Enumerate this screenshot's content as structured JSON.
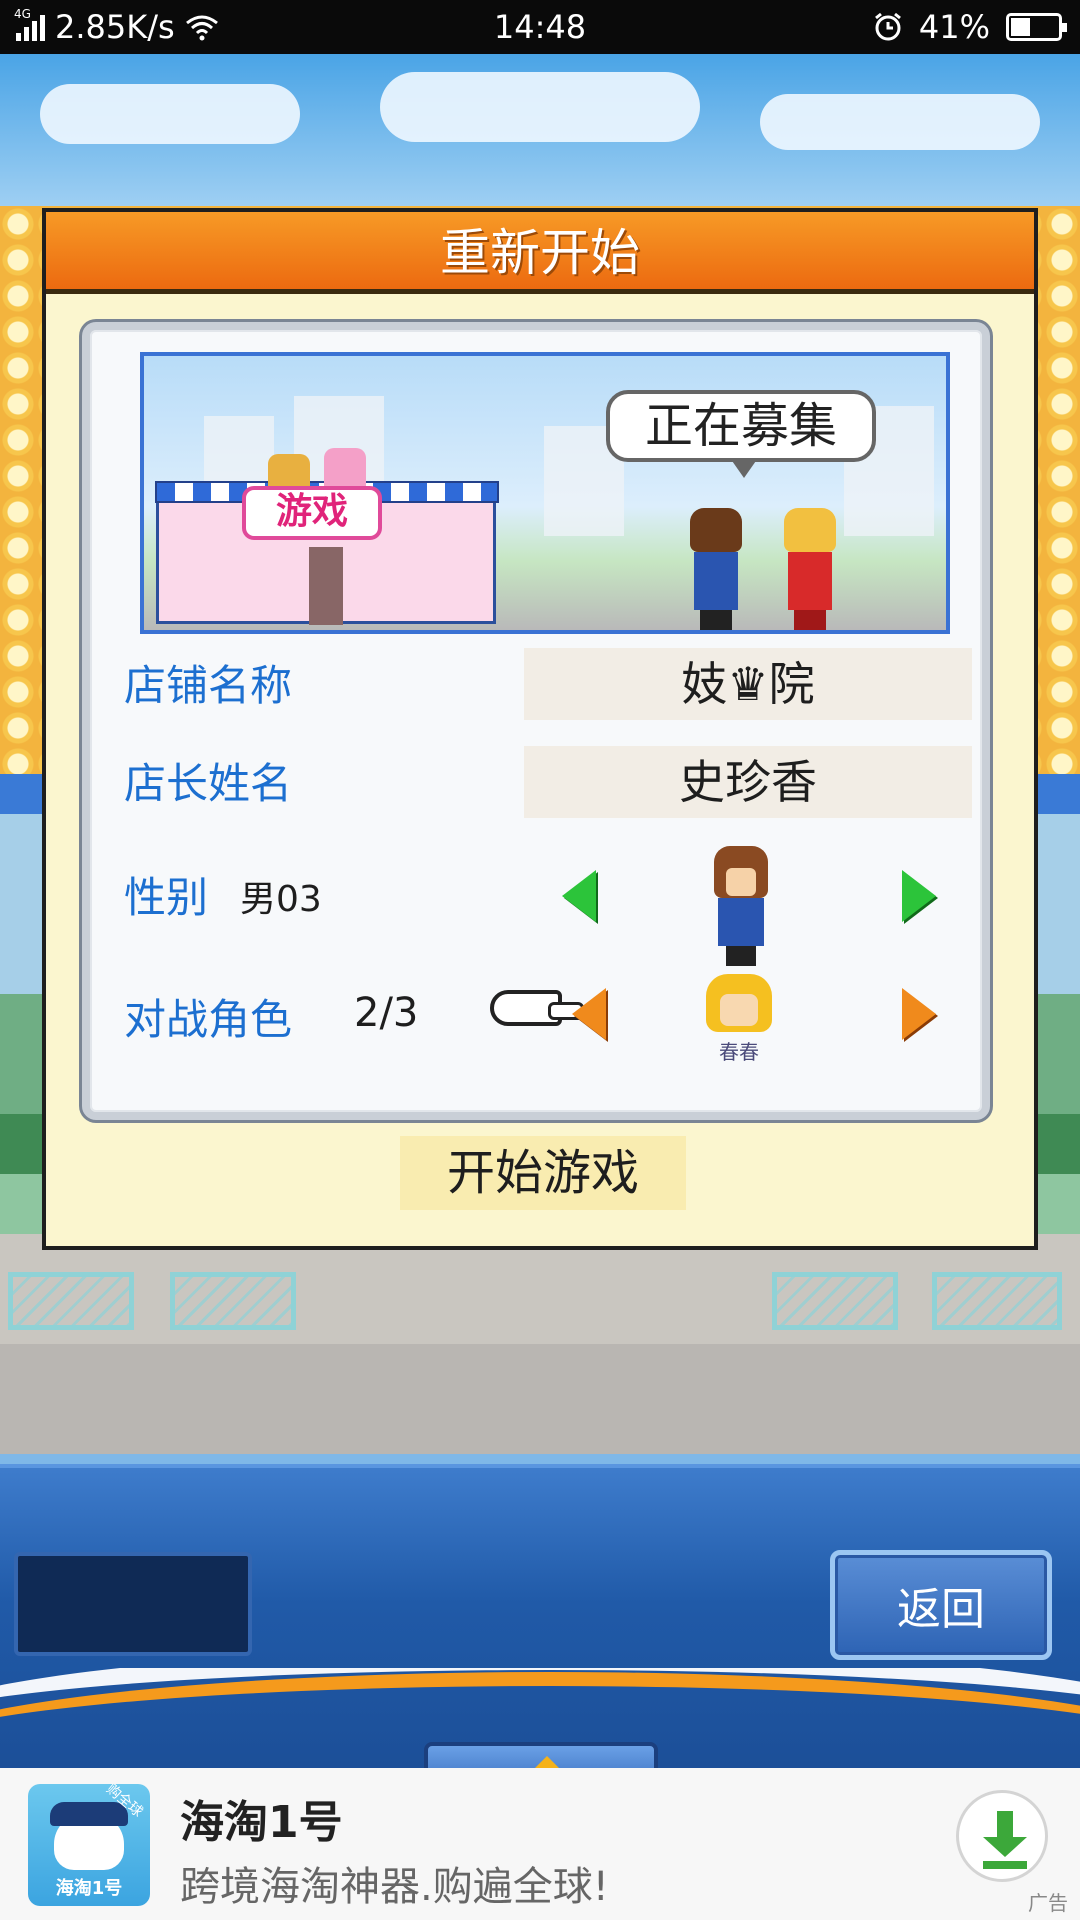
{
  "status_bar": {
    "network_type": "4G",
    "speed": "2.85K/s",
    "time": "14:48",
    "battery": "41%",
    "battery_level": 0.41,
    "icons": [
      "signal-icon",
      "wifi-icon",
      "alarm-icon",
      "battery-icon"
    ]
  },
  "dialog": {
    "title": "重新开始",
    "preview": {
      "shop_sign": "游戏",
      "speech_bubble": "正在募集"
    },
    "rows": {
      "shop_name_label": "店铺名称",
      "shop_name_value": "妓♛院",
      "manager_label": "店长姓名",
      "manager_value": "史珍香",
      "gender_label": "性别",
      "gender_value": "男03",
      "rival_label": "对战角色",
      "rival_value": "2/3",
      "rival_character_name": "春春"
    },
    "start_button": "开始游戏"
  },
  "bottom_ui": {
    "back_button": "返回"
  },
  "ad": {
    "title": "海淘1号",
    "subtitle": "跨境海淘神器.购遍全球!",
    "app_icon_label": "海淘1号",
    "app_icon_tag": "购全球",
    "ad_mark": "广告"
  },
  "colors": {
    "title_bar": "#ec6a10",
    "label_blue": "#1c6fd0",
    "green_arrow": "#2cc43a",
    "orange_arrow": "#f08a1c"
  }
}
